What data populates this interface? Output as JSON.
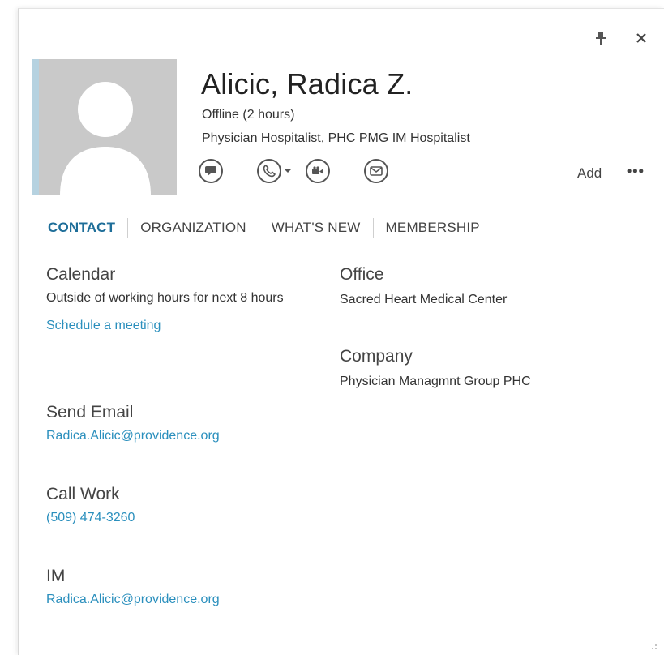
{
  "contact": {
    "name": "Alicic, Radica Z.",
    "status": "Offline (2 hours)",
    "title": "Physician Hospitalist, PHC PMG IM Hospitalist"
  },
  "header": {
    "add_label": "Add",
    "more_label": "•••",
    "icons": [
      "pin-icon",
      "close-icon",
      "chat-icon",
      "phone-icon",
      "video-icon",
      "mail-icon"
    ]
  },
  "tabs": [
    {
      "label": "CONTACT",
      "active": true
    },
    {
      "label": "ORGANIZATION",
      "active": false
    },
    {
      "label": "WHAT'S NEW",
      "active": false
    },
    {
      "label": "MEMBERSHIP",
      "active": false
    }
  ],
  "calendar": {
    "heading": "Calendar",
    "text": "Outside of working hours for next 8 hours",
    "link": "Schedule a meeting"
  },
  "send_email": {
    "heading": "Send Email",
    "link": "Radica.Alicic@providence.org"
  },
  "call_work": {
    "heading": "Call Work",
    "link": "(509) 474-3260"
  },
  "im": {
    "heading": "IM",
    "link": "Radica.Alicic@providence.org"
  },
  "office": {
    "heading": "Office",
    "text": "Sacred Heart Medical Center"
  },
  "company": {
    "heading": "Company",
    "text": "Physician Managmnt Group PHC"
  },
  "colors": {
    "accent": "#1e6e99",
    "link": "#2a8fbd",
    "avatar_bg": "#c9c9c9",
    "presence": "#b6d2e0"
  }
}
